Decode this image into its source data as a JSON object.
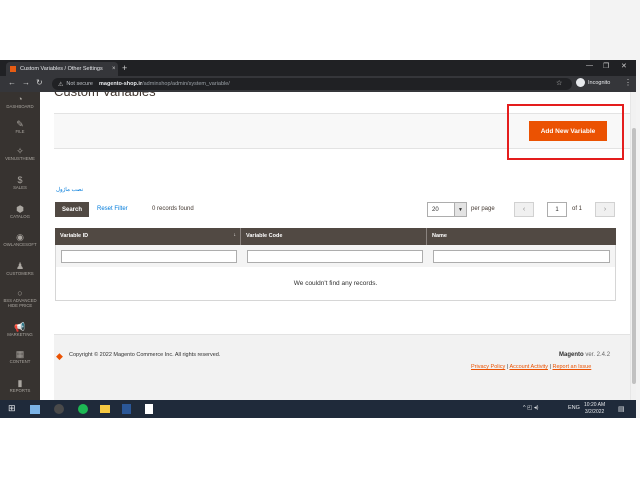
{
  "browser": {
    "tab_title": "Custom Variables / Other Settings",
    "tab_close": "×",
    "new_tab": "+",
    "win_minimize": "—",
    "win_restore": "❐",
    "win_close": "✕",
    "back": "←",
    "forward": "→",
    "reload": "↻",
    "warning_glyph": "⚠",
    "not_secure": "Not secure",
    "url_host": "magento-shop.ir",
    "url_path": "/adminshop/admin/system_variable/",
    "star": "☆",
    "incognito_label": "Incognito",
    "menu": "⋮"
  },
  "sidebar": {
    "items": [
      {
        "icon": "dashboard-icon",
        "glyph": "◔",
        "label": "DASHBOARD"
      },
      {
        "icon": "file-icon",
        "glyph": "✎",
        "label": "FILE"
      },
      {
        "icon": "venustheme-icon",
        "glyph": "✧",
        "label": "VENUSTHEME"
      },
      {
        "icon": "sales-icon",
        "glyph": "$",
        "label": "SALES"
      },
      {
        "icon": "catalog-icon",
        "glyph": "⬢",
        "label": "CATALOG"
      },
      {
        "icon": "ownlancesoft-icon",
        "glyph": "◉",
        "label": "OWLANCESOFT"
      },
      {
        "icon": "customers-icon",
        "glyph": "♟",
        "label": "CUSTOMERS"
      },
      {
        "icon": "bss-advanced-icon",
        "glyph": "○",
        "label": "BSS ADVANCED HIDE PRICE"
      },
      {
        "icon": "marketing-icon",
        "glyph": "📢",
        "label": "MARKETING"
      },
      {
        "icon": "content-icon",
        "glyph": "▦",
        "label": "CONTENT"
      },
      {
        "icon": "reports-icon",
        "glyph": "▮",
        "label": "REPORTS"
      }
    ]
  },
  "page": {
    "title": "Custom Variables",
    "add_button": "Add New Variable",
    "rtl_link": "نصب ماژول",
    "search_button": "Search",
    "reset_filter": "Reset Filter",
    "records_found": "0 records found",
    "per_page_value": "20",
    "per_page_arrow": "▼",
    "per_page_label": "per page",
    "prev": "‹",
    "next": "›",
    "page_number": "1",
    "page_of": "of 1",
    "columns": [
      "Variable ID",
      "Variable Code",
      "Name"
    ],
    "sort_glyph": "↓",
    "empty_message": "We couldn't find any records."
  },
  "footer": {
    "logo_glyph": "◆",
    "copyright": "Copyright © 2022 Magento Commerce Inc. All rights reserved.",
    "brand": "Magento",
    "version": "ver. 2.4.2",
    "privacy": "Privacy Policy",
    "activity": "Account Activity",
    "report": "Report an Issue",
    "sep": "|"
  },
  "taskbar": {
    "start_glyph": "⊞",
    "tray_glyph": "^ ◰ ◂)",
    "lang": "ENG",
    "time": "10:20 AM",
    "date": "3/2/2022",
    "notify_glyph": "▤"
  },
  "colors": {
    "accent": "#eb5202",
    "highlight_box": "#e41d1d",
    "sidebar": "#373330",
    "grid_header": "#514943"
  }
}
